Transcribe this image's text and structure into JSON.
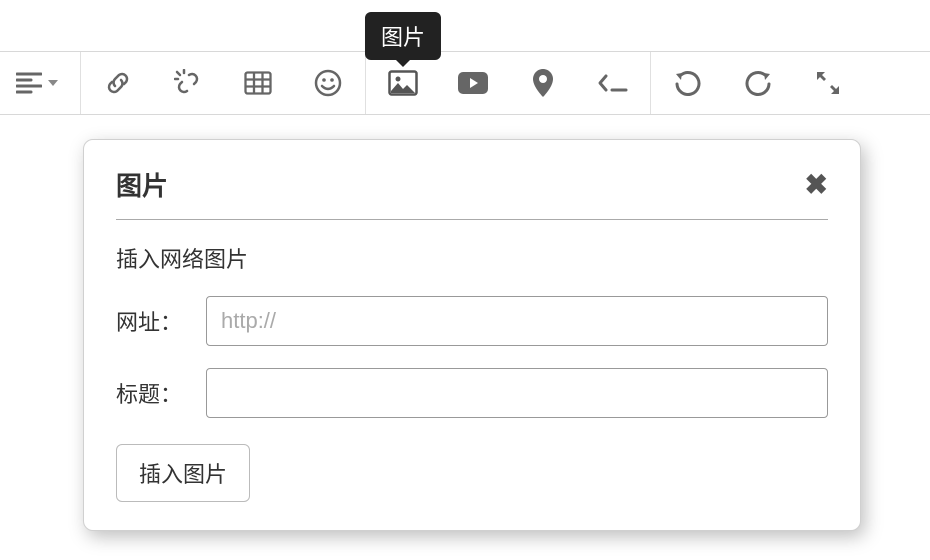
{
  "toolbar": {
    "tooltip_image": "图片"
  },
  "panel": {
    "title": "图片",
    "subtitle": "插入网络图片",
    "url_label": "网址：",
    "url_placeholder": "http://",
    "title_label": "标题：",
    "submit_label": "插入图片"
  }
}
